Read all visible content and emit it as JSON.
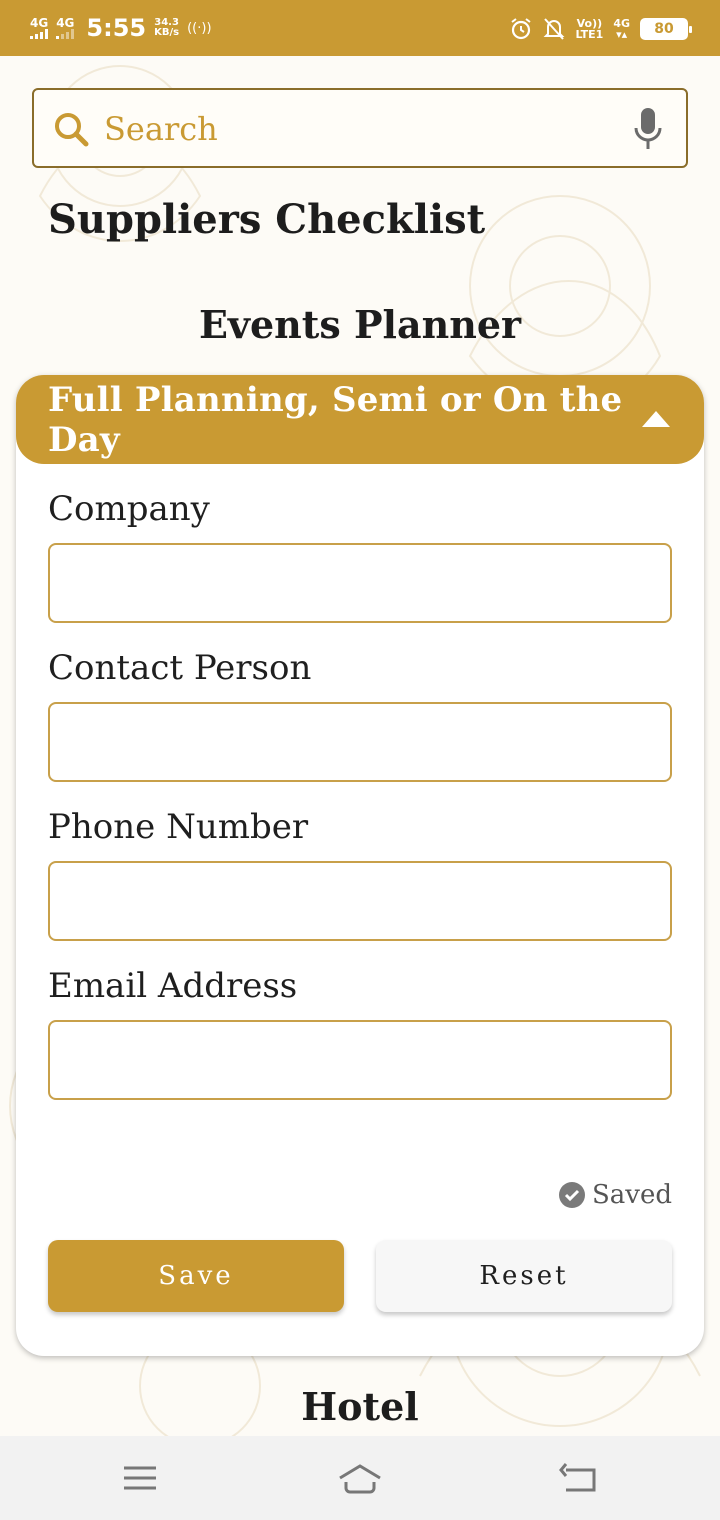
{
  "status_bar": {
    "net1": "4G",
    "net2": "4G",
    "time": "5:55",
    "speed_value": "34.3",
    "speed_unit": "KB/s",
    "volte_top": "Vo))",
    "volte_bottom": "LTE1",
    "net3": "4G",
    "battery": "80"
  },
  "search": {
    "placeholder": "Search"
  },
  "page_title": "Suppliers Checklist",
  "section": {
    "title": "Events Planner",
    "card_header": "Full Planning, Semi or On the Day",
    "fields": [
      {
        "label": "Company",
        "value": ""
      },
      {
        "label": "Contact Person",
        "value": ""
      },
      {
        "label": "Phone Number",
        "value": ""
      },
      {
        "label": "Email Address",
        "value": ""
      }
    ],
    "saved_label": "Saved",
    "save_label": "Save",
    "reset_label": "Reset"
  },
  "next_section": {
    "title": "Hotel"
  },
  "colors": {
    "accent": "#c99a33",
    "border": "#c8a04a",
    "text": "#1f1f1f"
  }
}
